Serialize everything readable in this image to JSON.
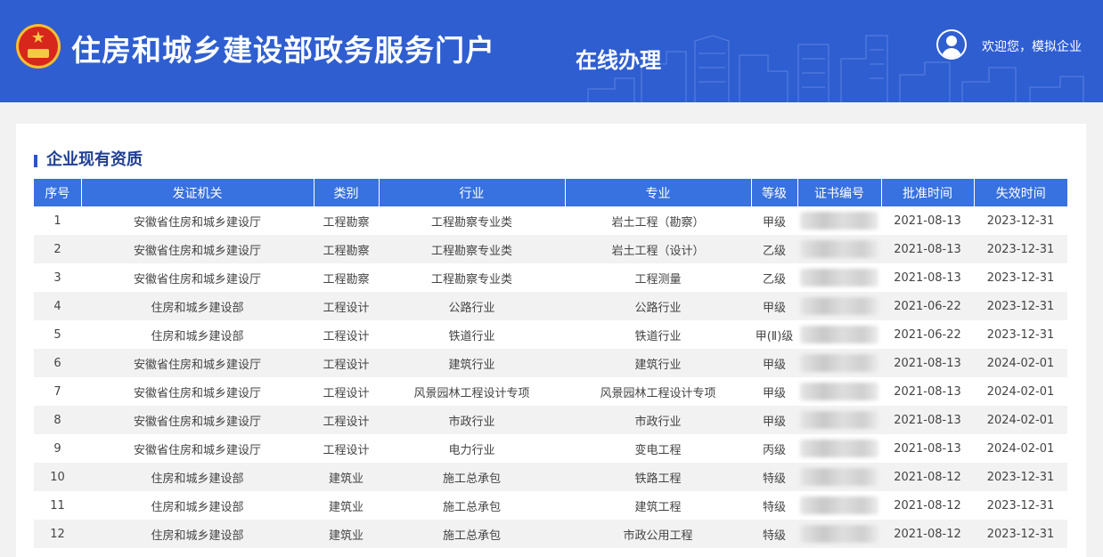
{
  "header": {
    "site_title": "住房和城乡建设部政务服务门户",
    "sub_title": "在线办理",
    "welcome_text": "欢迎您，模拟企业",
    "bg_color": "#2f5ed1"
  },
  "section": {
    "title": "企业现有资质"
  },
  "table": {
    "columns": [
      "序号",
      "发证机关",
      "类别",
      "行业",
      "专业",
      "等级",
      "证书编号",
      "批准时间",
      "失效时间"
    ],
    "rows": [
      {
        "no": "1",
        "authority": "安徽省住房和城乡建设厅",
        "category": "工程勘察",
        "industry": "工程勘察专业类",
        "major": "岩土工程（勘察）",
        "grade": "甲级",
        "approved": "2021-08-13",
        "expires": "2023-12-31"
      },
      {
        "no": "2",
        "authority": "安徽省住房和城乡建设厅",
        "category": "工程勘察",
        "industry": "工程勘察专业类",
        "major": "岩土工程（设计）",
        "grade": "乙级",
        "approved": "2021-08-13",
        "expires": "2023-12-31"
      },
      {
        "no": "3",
        "authority": "安徽省住房和城乡建设厅",
        "category": "工程勘察",
        "industry": "工程勘察专业类",
        "major": "工程测量",
        "grade": "乙级",
        "approved": "2021-08-13",
        "expires": "2023-12-31"
      },
      {
        "no": "4",
        "authority": "住房和城乡建设部",
        "category": "工程设计",
        "industry": "公路行业",
        "major": "公路行业",
        "grade": "甲级",
        "approved": "2021-06-22",
        "expires": "2023-12-31"
      },
      {
        "no": "5",
        "authority": "住房和城乡建设部",
        "category": "工程设计",
        "industry": "铁道行业",
        "major": "铁道行业",
        "grade": "甲(Ⅱ)级",
        "approved": "2021-06-22",
        "expires": "2023-12-31"
      },
      {
        "no": "6",
        "authority": "安徽省住房和城乡建设厅",
        "category": "工程设计",
        "industry": "建筑行业",
        "major": "建筑行业",
        "grade": "甲级",
        "approved": "2021-08-13",
        "expires": "2024-02-01"
      },
      {
        "no": "7",
        "authority": "安徽省住房和城乡建设厅",
        "category": "工程设计",
        "industry": "风景园林工程设计专项",
        "major": "风景园林工程设计专项",
        "grade": "甲级",
        "approved": "2021-08-13",
        "expires": "2024-02-01"
      },
      {
        "no": "8",
        "authority": "安徽省住房和城乡建设厅",
        "category": "工程设计",
        "industry": "市政行业",
        "major": "市政行业",
        "grade": "甲级",
        "approved": "2021-08-13",
        "expires": "2024-02-01"
      },
      {
        "no": "9",
        "authority": "安徽省住房和城乡建设厅",
        "category": "工程设计",
        "industry": "电力行业",
        "major": "变电工程",
        "grade": "丙级",
        "approved": "2021-08-13",
        "expires": "2024-02-01"
      },
      {
        "no": "10",
        "authority": "住房和城乡建设部",
        "category": "建筑业",
        "industry": "施工总承包",
        "major": "铁路工程",
        "grade": "特级",
        "approved": "2021-08-12",
        "expires": "2023-12-31"
      },
      {
        "no": "11",
        "authority": "住房和城乡建设部",
        "category": "建筑业",
        "industry": "施工总承包",
        "major": "建筑工程",
        "grade": "特级",
        "approved": "2021-08-12",
        "expires": "2023-12-31"
      },
      {
        "no": "12",
        "authority": "住房和城乡建设部",
        "category": "建筑业",
        "industry": "施工总承包",
        "major": "市政公用工程",
        "grade": "特级",
        "approved": "2021-08-12",
        "expires": "2023-12-31"
      }
    ]
  }
}
